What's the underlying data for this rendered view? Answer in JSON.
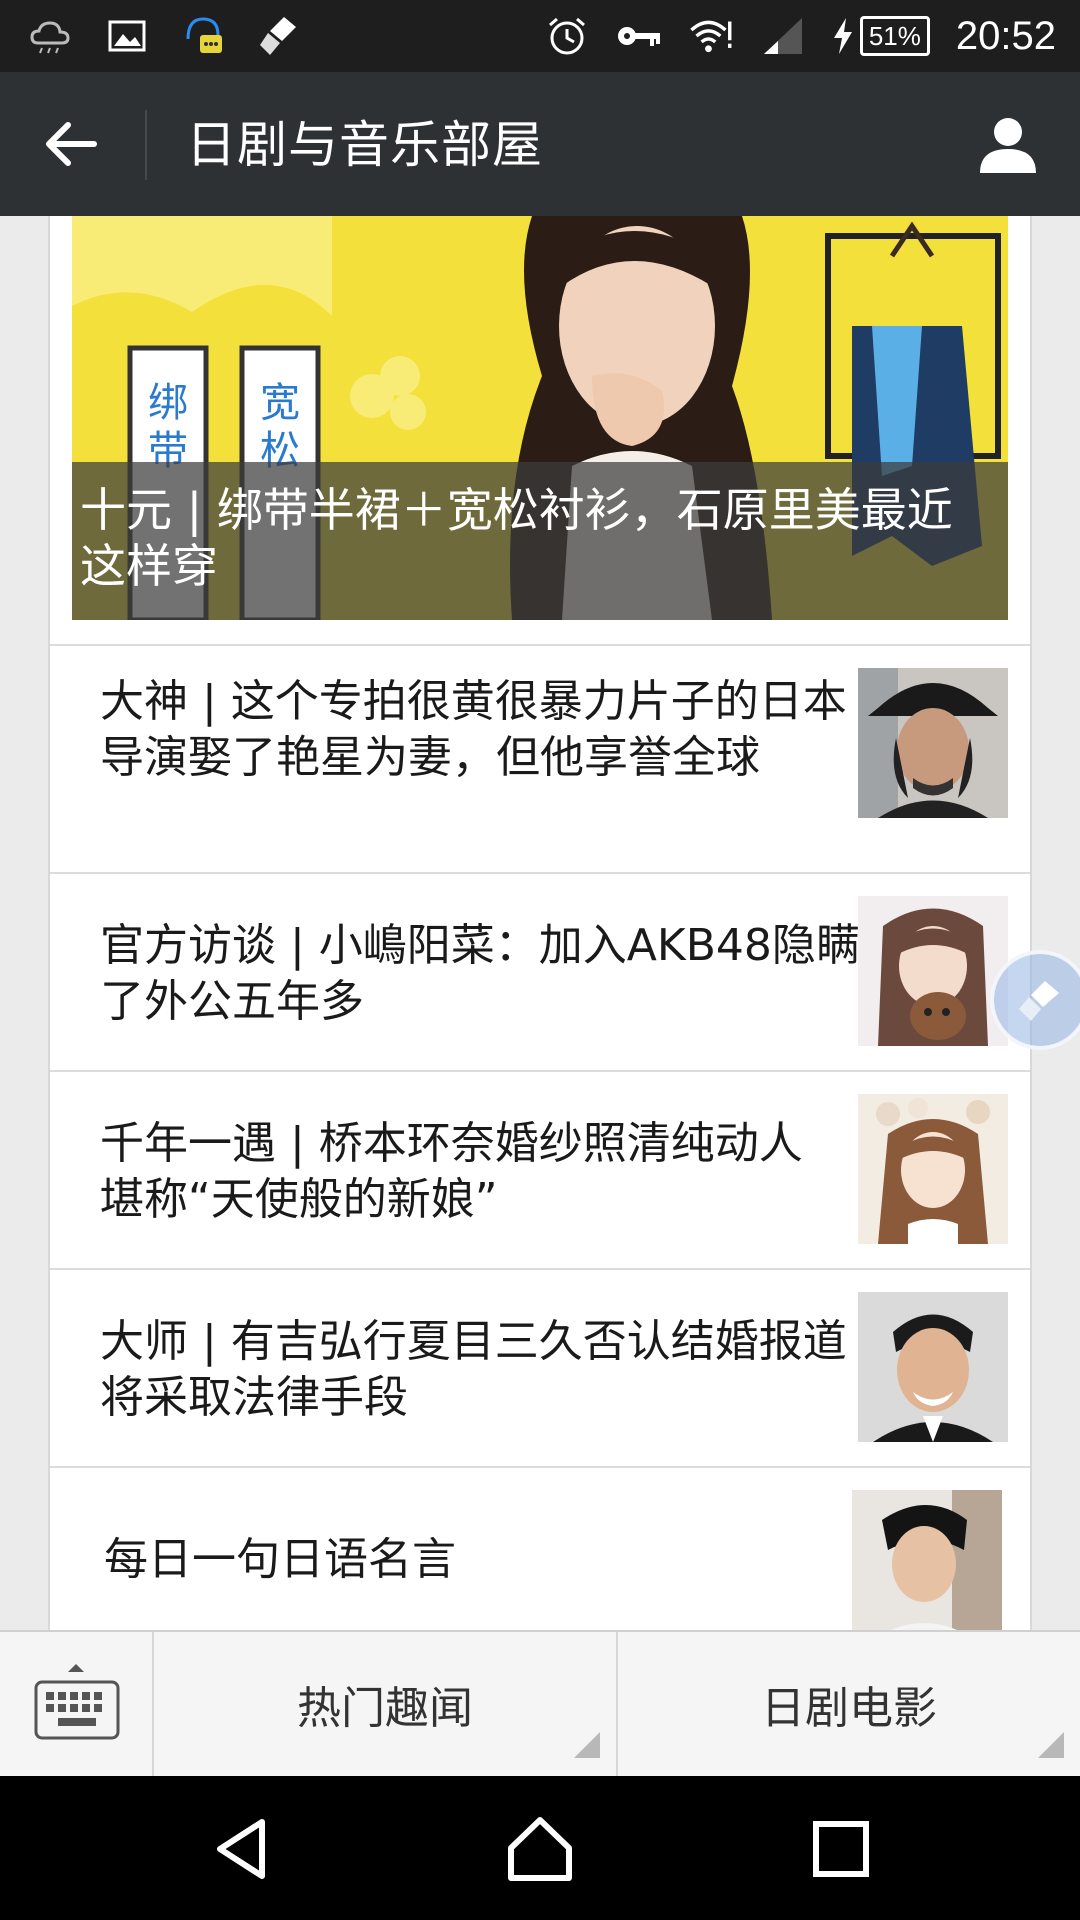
{
  "status_bar": {
    "icons_left": [
      "weather-icon",
      "image-icon",
      "support-chat-icon",
      "cleaner-icon"
    ],
    "icons_right": [
      "alarm-icon",
      "key-icon",
      "wifi-icon",
      "signal-icon",
      "charging-icon"
    ],
    "battery": "51%",
    "time": "20:52"
  },
  "header": {
    "title": "日剧与音乐部屋"
  },
  "cover": {
    "caption": "十元 | 绑带半裙＋宽松衬衫，石原里美最近这样穿",
    "overlay_text_left": "绑带",
    "overlay_text_right": "宽松"
  },
  "articles": [
    {
      "title": "大神 | 这个专拍很黄很暴力片子的日本导演娶了艳星为妻，但他享誉全球"
    },
    {
      "title": "官方访谈 | 小嶋阳菜：加入AKB48隐瞒了外公五年多"
    },
    {
      "title": "千年一遇 | 桥本环奈婚纱照清纯动人 堪称“天使般的新娘”"
    },
    {
      "title": "大师 | 有吉弘行夏目三久否认结婚报道 将采取法律手段"
    },
    {
      "title": "每日一句日语名言"
    }
  ],
  "menu": {
    "items": [
      {
        "label": "热门趣闻"
      },
      {
        "label": "日剧电影"
      }
    ]
  },
  "colors": {
    "status_bar": "#1e1e1e",
    "title_bar": "#2e3134",
    "background": "#ebebeb",
    "cover_yellow": "#f3e03a"
  }
}
